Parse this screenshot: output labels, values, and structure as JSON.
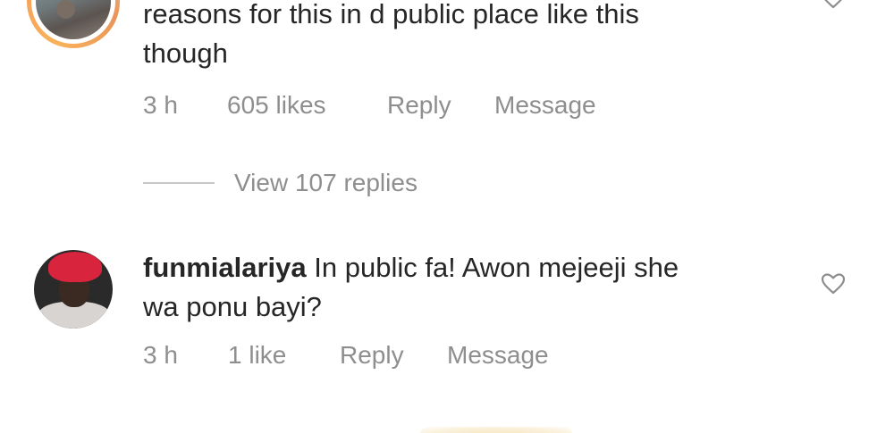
{
  "comments": [
    {
      "text_lines": [
        "reasons for this in d public place like this",
        "though"
      ],
      "time": "3 h",
      "likes": "605 likes",
      "reply_label": "Reply",
      "message_label": "Message",
      "view_replies_label": "View 107 replies",
      "liked": false
    },
    {
      "username": "funmialariya",
      "text": "In public fa! Awon mejeeji she",
      "text_line2": "wa ponu bayi?",
      "time": "3 h",
      "likes": "1 like",
      "reply_label": "Reply",
      "message_label": "Message",
      "liked": false
    }
  ],
  "icons": {
    "like": "heart-outline-icon"
  },
  "colors": {
    "text_primary": "#262626",
    "text_secondary": "#8e8e8e",
    "avatar_ring": "#f6a15b",
    "background": "#ffffff"
  }
}
